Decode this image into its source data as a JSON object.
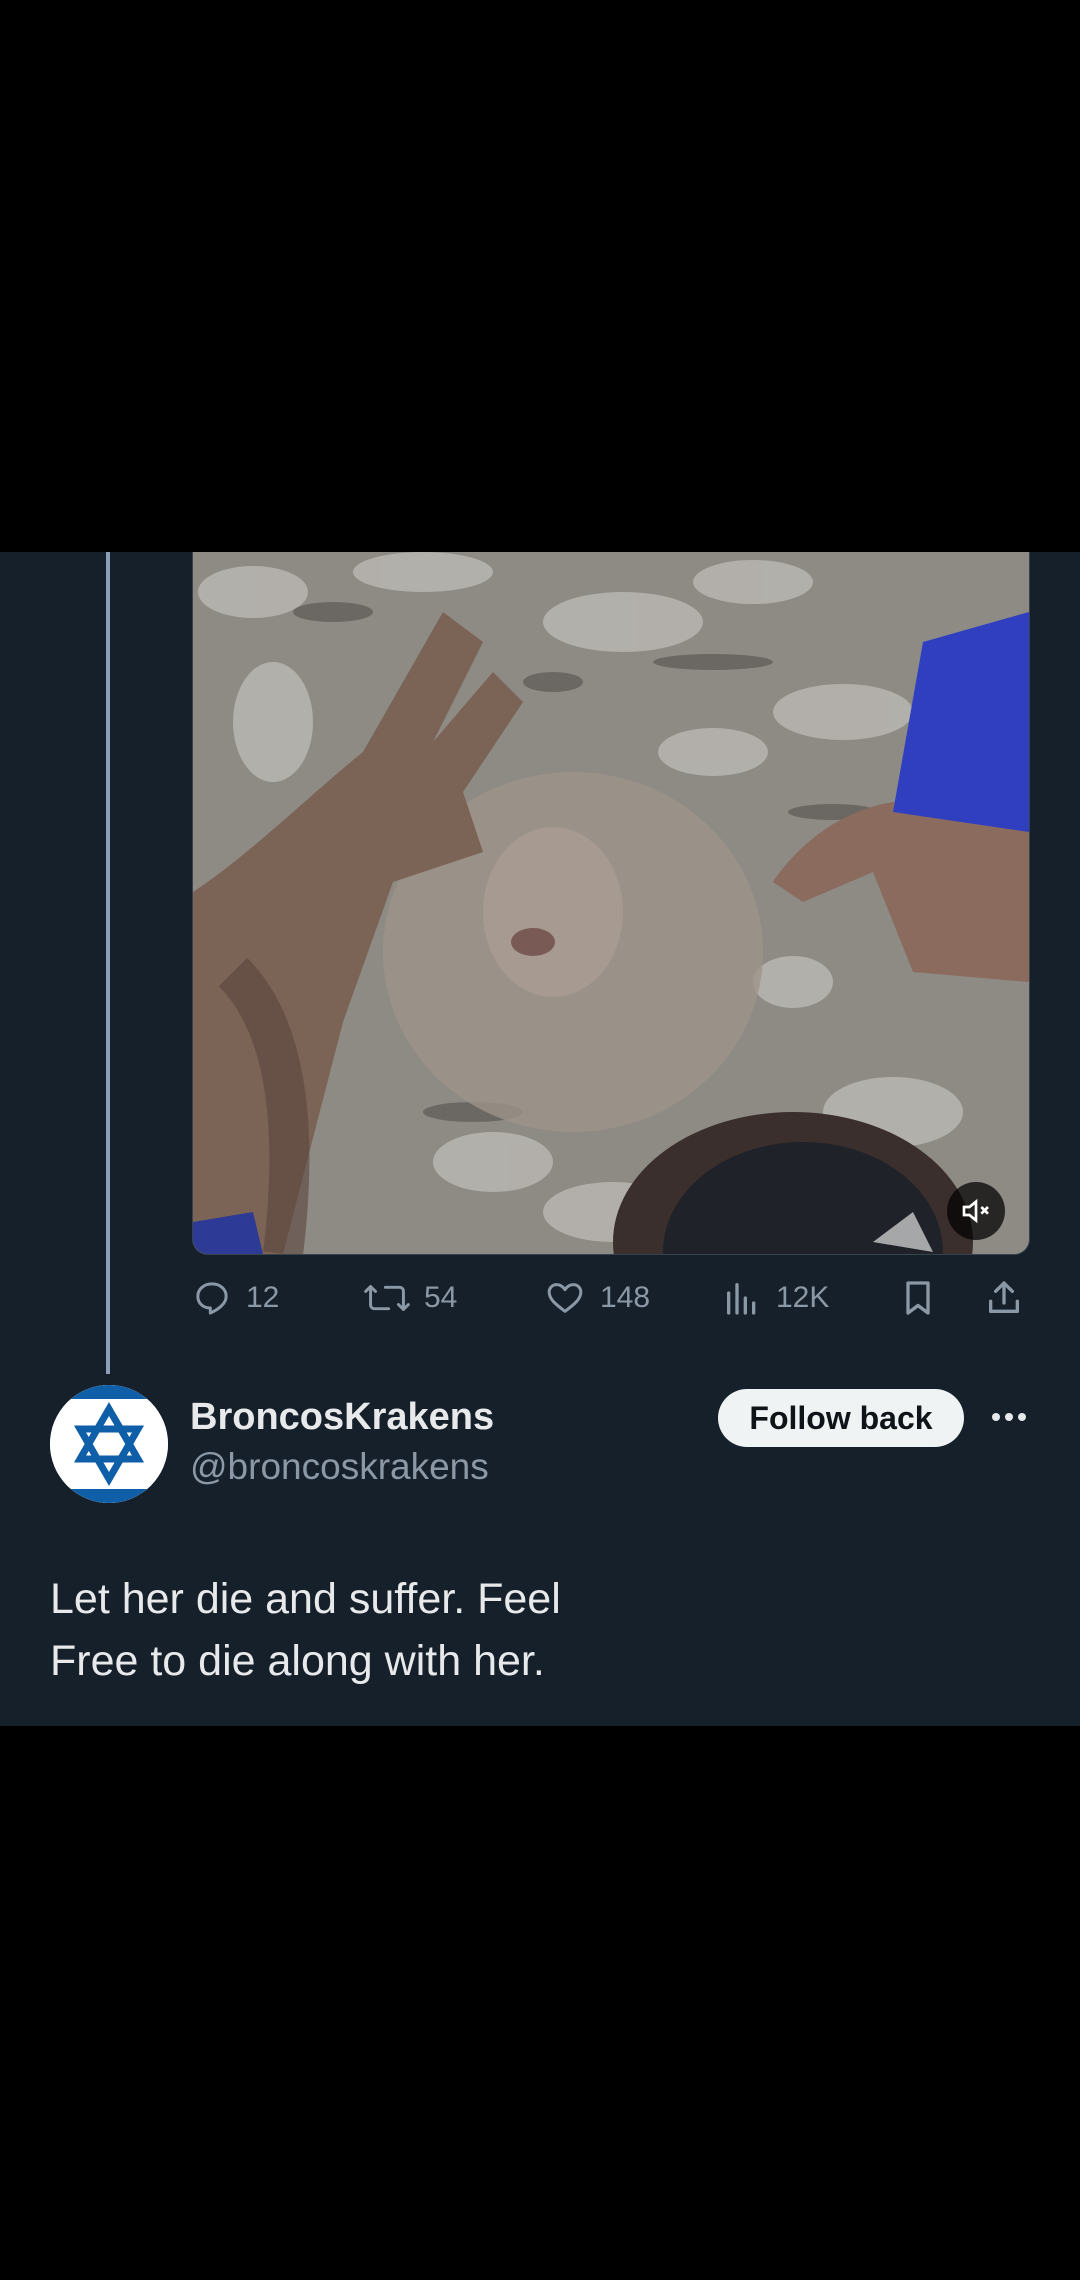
{
  "quoted_post": {
    "media": {
      "type": "video",
      "mute_icon": "speaker-muted-icon"
    },
    "actions": {
      "replies": "12",
      "reposts": "54",
      "likes": "148",
      "views": "12K",
      "bookmark_icon": "bookmark-icon",
      "share_icon": "share-icon"
    }
  },
  "reply": {
    "author": {
      "display_name": "BroncosKrakens",
      "handle": "@broncoskrakens",
      "avatar_icon": "star-of-david-flag-avatar"
    },
    "follow_label": "Follow back",
    "more_icon": "more-options-icon",
    "text_lines": [
      "Let her die and suffer. Feel",
      "Free to die along with her."
    ]
  },
  "colors": {
    "background": "#15202b",
    "text_primary": "#e7e9ea",
    "text_secondary": "#8b98a5",
    "thread_line": "#8ba0b4",
    "follow_button_bg": "#eff3f4",
    "avatar_star": "#0f5ea8"
  }
}
